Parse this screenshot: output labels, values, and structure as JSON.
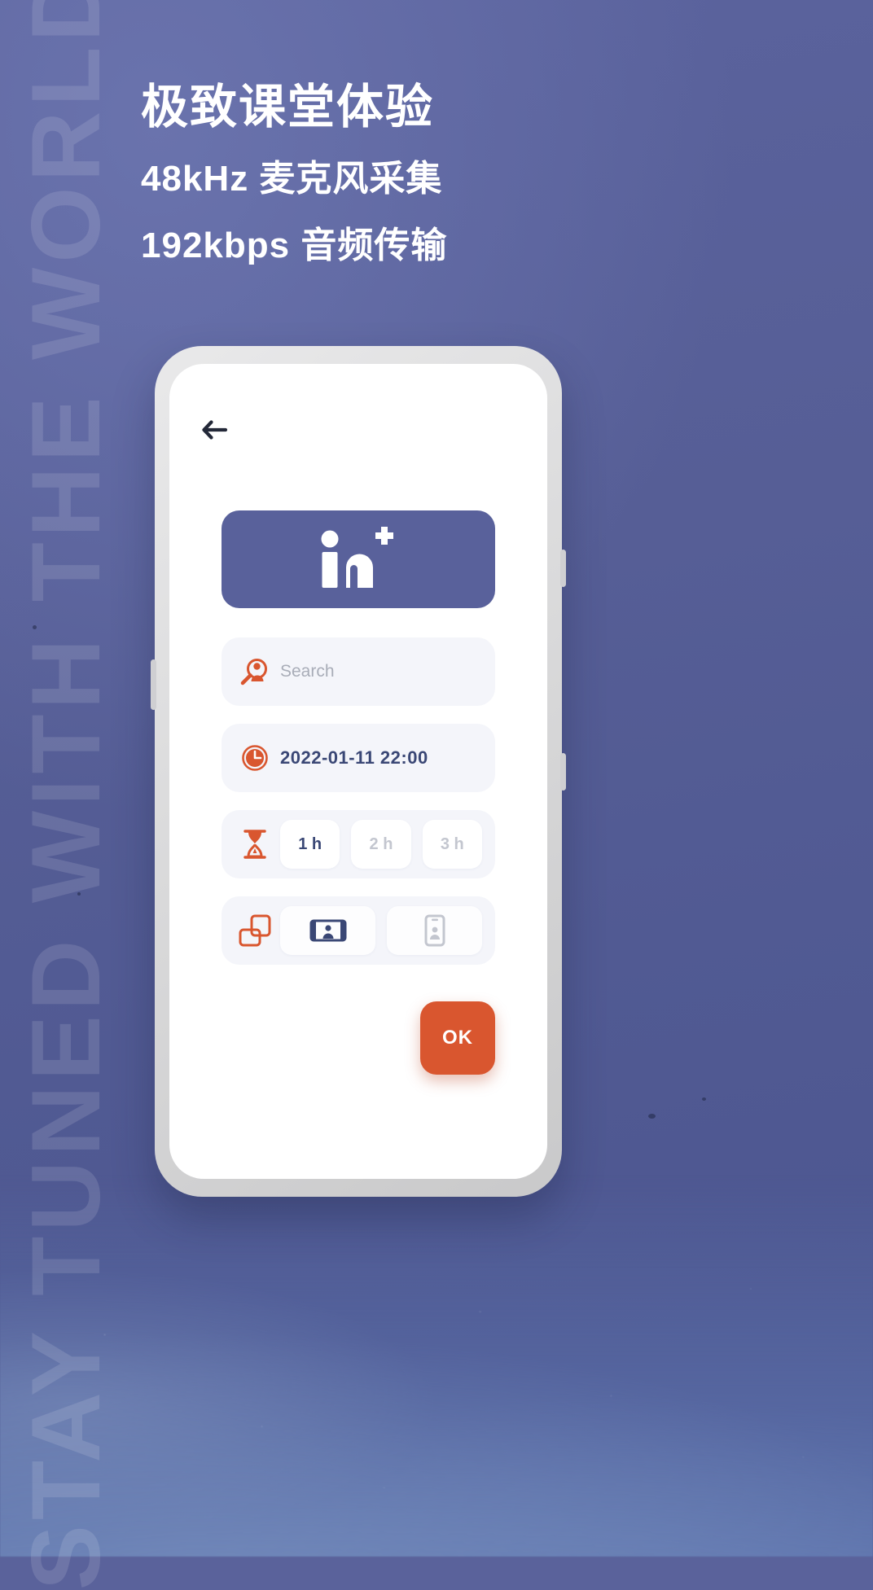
{
  "poster": {
    "background_color": "#565e96",
    "accent_color": "#d9562f",
    "brand_blue": "#59619b",
    "headline": "极致课堂体验",
    "subline_1": "48kHz 麦克风采集",
    "subline_2": "192kbps 音频传输",
    "watermark_text": "STAY TUNED WITH THE WORLD"
  },
  "phone": {
    "screen": {
      "back_icon": "back-arrow-icon",
      "logo": {
        "icon": "in-plus-logo-icon",
        "alt_text": "in+"
      },
      "search": {
        "icon": "search-person-icon",
        "placeholder": "Search",
        "value": ""
      },
      "datetime": {
        "icon": "clock-icon",
        "value": "2022-01-11  22:00"
      },
      "duration": {
        "icon": "hourglass-icon",
        "options": [
          {
            "label": "1 h",
            "selected": true
          },
          {
            "label": "2 h",
            "selected": false
          },
          {
            "label": "3 h",
            "selected": false
          }
        ]
      },
      "orientation": {
        "icon": "rotate-phone-icon",
        "options": [
          {
            "icon": "landscape-screen-icon",
            "selected": true
          },
          {
            "icon": "portrait-screen-icon",
            "selected": false
          }
        ]
      },
      "confirm_button": {
        "label": "OK"
      }
    }
  }
}
